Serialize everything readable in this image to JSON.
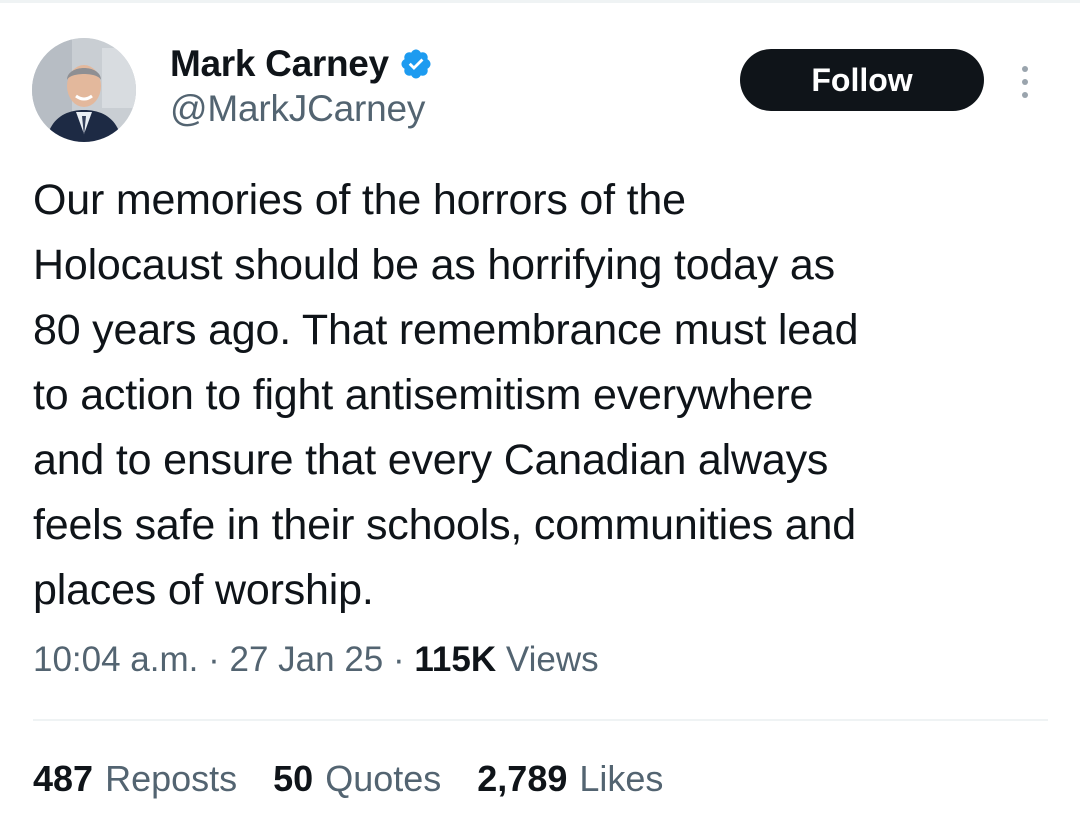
{
  "author": {
    "name": "Mark Carney",
    "handle": "@MarkJCarney",
    "verified": true
  },
  "follow_label": "Follow",
  "tweet": {
    "text": "Our memories of the horrors of the\nHolocaust should be as horrifying today as\n80 years ago. That remembrance must lead\nto action to fight antisemitism everywhere\nand to ensure that every Canadian always\nfeels safe in their schools, communities and\nplaces of worship."
  },
  "meta": {
    "time": "10:04 a.m.",
    "separator": "·",
    "date": "27 Jan 25",
    "views_count": "115K",
    "views_label": "Views"
  },
  "stats": {
    "reposts": {
      "count": "487",
      "label": "Reposts"
    },
    "quotes": {
      "count": "50",
      "label": "Quotes"
    },
    "likes": {
      "count": "2,789",
      "label": "Likes"
    }
  },
  "colors": {
    "verified_badge": "#1d9bf0",
    "follow_button": "#0f1419",
    "secondary_text": "#536471"
  }
}
